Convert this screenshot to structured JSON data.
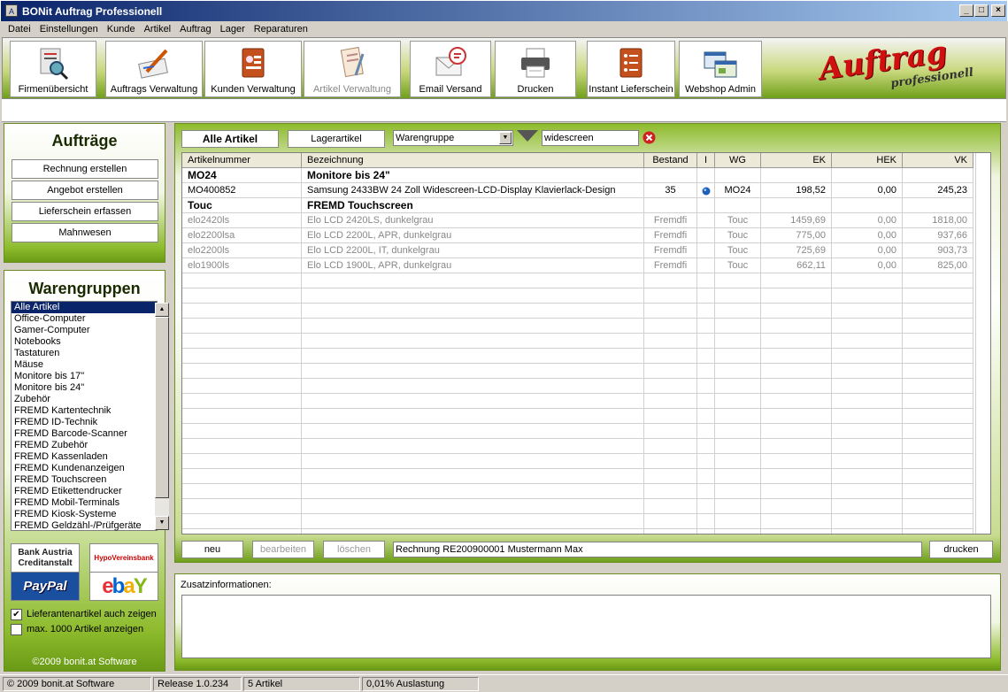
{
  "window": {
    "title": "BONit Auftrag Professionell",
    "app_icon": "A"
  },
  "menu": [
    "Datei",
    "Einstellungen",
    "Kunde",
    "Artikel",
    "Auftrag",
    "Lager",
    "Reparaturen"
  ],
  "toolbar": [
    {
      "label": "Firmenübersicht",
      "icon": "magnifier-icon"
    },
    {
      "label": "Auftrags Verwaltung",
      "icon": "pen-paper-icon"
    },
    {
      "label": "Kunden Verwaltung",
      "icon": "contacts-book-icon"
    },
    {
      "label": "Artikel Verwaltung",
      "icon": "notebook-icon"
    },
    {
      "label": "Email Versand",
      "icon": "envelope-icon"
    },
    {
      "label": "Drucken",
      "icon": "printer-icon"
    },
    {
      "label": "Instant Lieferschein",
      "icon": "checklist-icon"
    },
    {
      "label": "Webshop Admin",
      "icon": "browser-windows-icon"
    }
  ],
  "logo": {
    "line1": "Auftrag",
    "line2": "professionell"
  },
  "auftraege": {
    "title": "Aufträge",
    "buttons": [
      "Rechnung erstellen",
      "Angebot erstellen",
      "Lieferschein erfassen",
      "Mahnwesen"
    ]
  },
  "warengruppen": {
    "title": "Warengruppen",
    "items": [
      "Alle Artikel",
      "Office-Computer",
      "Gamer-Computer",
      "Notebooks",
      "Tastaturen",
      "Mäuse",
      "Monitore bis 17\"",
      "Monitore bis 24\"",
      "Zubehör",
      "FREMD Kartentechnik",
      "FREMD ID-Technik",
      "FREMD Barcode-Scanner",
      "FREMD Zubehör",
      "FREMD Kassenladen",
      "FREMD Kundenanzeigen",
      "FREMD Touchscreen",
      "FREMD Etikettendrucker",
      "FREMD Mobil-Terminals",
      "FREMD Kiosk-Systeme",
      "FREMD Geldzähl-/Prüfgeräte"
    ],
    "selected": 0
  },
  "partners": {
    "bank_austria_1": "Bank Austria",
    "bank_austria_2": "Creditanstalt",
    "hypo": "HypoVereinsbank",
    "paypal": "PayPal",
    "ebay_e": "e",
    "ebay_b": "b",
    "ebay_a": "a",
    "ebay_y": "Y"
  },
  "options": {
    "lieferanten": "Lieferantenartikel auch zeigen",
    "lieferanten_checked": "✔",
    "max": "max. 1000 Artikel anzeigen"
  },
  "copyright": "©2009 bonit.at Software",
  "filter": {
    "alle": "Alle Artikel",
    "lager": "Lagerartikel",
    "warengruppe": "Warengruppe",
    "search": "widescreen"
  },
  "table": {
    "headers": [
      "Artikelnummer",
      "Bezeichnung",
      "Bestand",
      "I",
      "WG",
      "EK",
      "HEK",
      "VK"
    ],
    "rows": [
      {
        "type": "group",
        "nr": "MO24",
        "bez": "Monitore bis 24\""
      },
      {
        "type": "item",
        "nr": "MO400852",
        "bez": "Samsung 2433BW 24 Zoll Widescreen-LCD-Display Klavierlack-Design",
        "bestand": "35",
        "i": "info",
        "wg": "MO24",
        "ek": "198,52",
        "hek": "0,00",
        "vk": "245,23"
      },
      {
        "type": "group",
        "nr": "Touc",
        "bez": "FREMD Touchscreen"
      },
      {
        "type": "gray",
        "nr": "elo2420ls",
        "bez": "Elo LCD 2420LS, dunkelgrau",
        "bestand": "Fremdfi",
        "i": "",
        "wg": "Touc",
        "ek": "1459,69",
        "hek": "0,00",
        "vk": "1818,00"
      },
      {
        "type": "gray",
        "nr": "elo2200lsa",
        "bez": "Elo LCD 2200L, APR, dunkelgrau",
        "bestand": "Fremdfi",
        "i": "",
        "wg": "Touc",
        "ek": "775,00",
        "hek": "0,00",
        "vk": "937,66"
      },
      {
        "type": "gray",
        "nr": "elo2200ls",
        "bez": "Elo LCD 2200L, IT, dunkelgrau",
        "bestand": "Fremdfi",
        "i": "",
        "wg": "Touc",
        "ek": "725,69",
        "hek": "0,00",
        "vk": "903,73"
      },
      {
        "type": "gray",
        "nr": "elo1900ls",
        "bez": "Elo LCD 1900L, APR, dunkelgrau",
        "bestand": "Fremdfi",
        "i": "",
        "wg": "Touc",
        "ek": "662,11",
        "hek": "0,00",
        "vk": "825,00"
      }
    ]
  },
  "actions": {
    "neu": "neu",
    "bearbeiten": "bearbeiten",
    "loeschen": "löschen",
    "info": "Rechnung RE200900001 Mustermann Max",
    "drucken": "drucken"
  },
  "zusatz": {
    "label": "Zusatzinformationen:"
  },
  "status": [
    "© 2009 bonit.at Software",
    "Release 1.0.234",
    "5 Artikel",
    "0,01% Auslastung"
  ]
}
